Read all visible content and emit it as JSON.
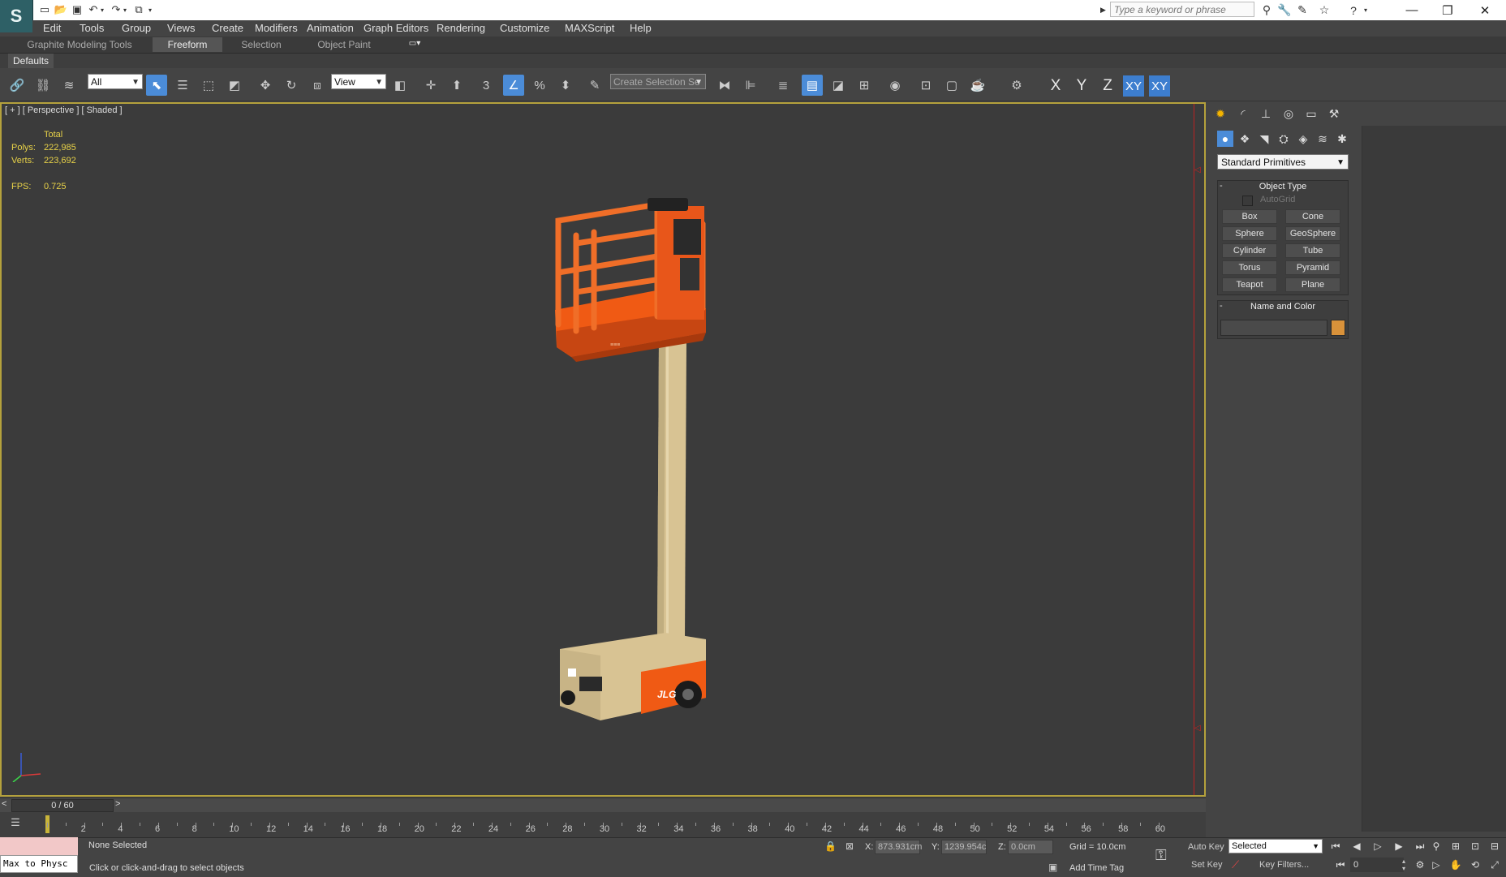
{
  "search": {
    "placeholder": "Type a keyword or phrase"
  },
  "menu": [
    "Edit",
    "Tools",
    "Group",
    "Views",
    "Create",
    "Modifiers",
    "Animation",
    "Graph Editors",
    "Rendering",
    "Customize",
    "MAXScript",
    "Help"
  ],
  "ribbon": {
    "tabs": [
      "Graphite Modeling Tools",
      "Freeform",
      "Selection",
      "Object Paint"
    ],
    "active": "Freeform",
    "defaults_label": "Defaults"
  },
  "toolbar": {
    "filter_value": "All",
    "ref_coord_value": "View",
    "snap_label": "3",
    "selection_set_placeholder": "Create Selection Se",
    "axes": [
      "X",
      "Y",
      "Z",
      "XY",
      "XY"
    ]
  },
  "viewport": {
    "label": "[ + ] [ Perspective ] [ Shaded ]",
    "stats": {
      "total_label": "Total",
      "polys_label": "Polys:",
      "polys_value": "222,985",
      "verts_label": "Verts:",
      "verts_value": "223,692",
      "fps_label": "FPS:",
      "fps_value": "0.725"
    },
    "model_brand": "JLG",
    "accent": "#f05a14",
    "mast_color": "#d8c393",
    "border_color": "#b4a13c"
  },
  "command_panel": {
    "dropdown_value": "Standard Primitives",
    "object_type": {
      "title": "Object Type",
      "autogrid": "AutoGrid",
      "buttons": [
        "Box",
        "Cone",
        "Sphere",
        "GeoSphere",
        "Cylinder",
        "Tube",
        "Torus",
        "Pyramid",
        "Teapot",
        "Plane"
      ]
    },
    "name_color": {
      "title": "Name and Color",
      "swatch": "#d9923a"
    }
  },
  "timeline": {
    "frame_display": "0 / 60",
    "ticks": [
      "2",
      "4",
      "6",
      "8",
      "10",
      "12",
      "14",
      "16",
      "18",
      "20",
      "22",
      "24",
      "26",
      "28",
      "30",
      "32",
      "34",
      "36",
      "38",
      "40",
      "42",
      "44",
      "46",
      "48",
      "50",
      "52",
      "54",
      "56",
      "58",
      "60"
    ]
  },
  "status": {
    "maxscript": "Max to Physc",
    "selection": "None Selected",
    "prompt": "Click or click-and-drag to select objects",
    "x_label": "X:",
    "x_value": "873.931cm",
    "y_label": "Y:",
    "y_value": "1239.954c",
    "z_label": "Z:",
    "z_value": "0.0cm",
    "grid": "Grid = 10.0cm",
    "add_time_tag": "Add Time Tag",
    "auto_key": "Auto Key",
    "set_key": "Set Key",
    "key_mode_value": "Selected",
    "key_filters": "Key Filters...",
    "frame_value": "0"
  }
}
